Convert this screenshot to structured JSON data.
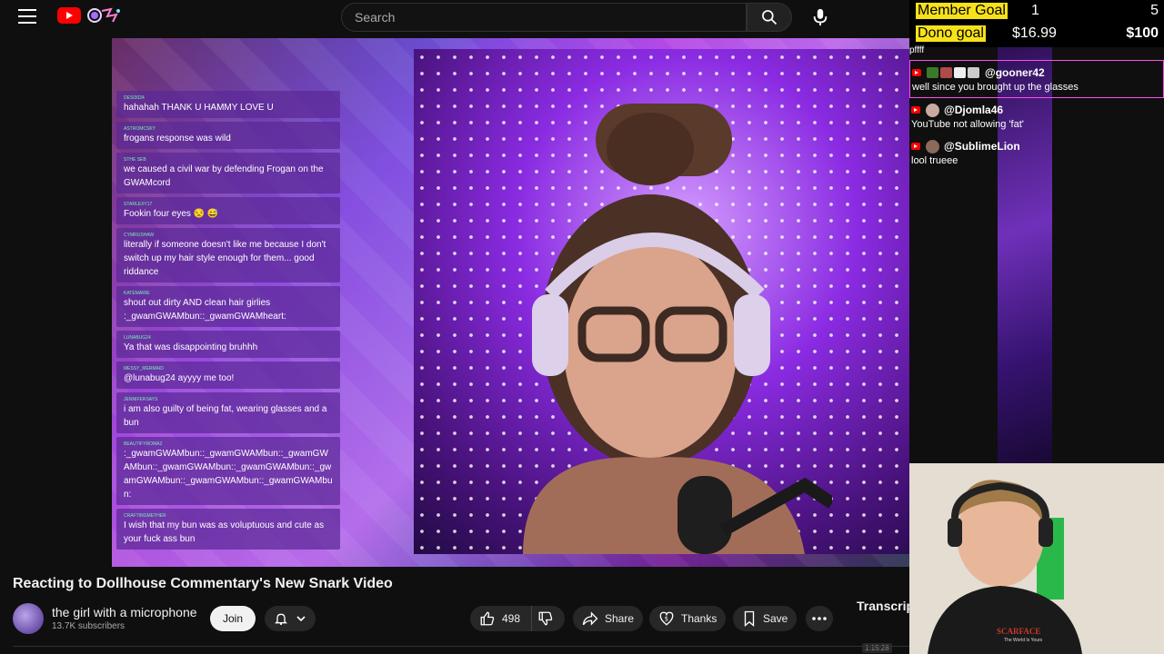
{
  "header": {
    "search_placeholder": "Search"
  },
  "video_chat_overlay": [
    {
      "user": "DESI3024",
      "text": "hahahah THANK U HAMMY LOVE U"
    },
    {
      "user": "ASTROMCSKY",
      "text": "frogans response was wild"
    },
    {
      "user": "STHE SEB",
      "text": "we caused a civil war by defending Frogan on the GWAMcord"
    },
    {
      "user": "STARLEXY17",
      "text": "Fookin four eyes 😒 😅"
    },
    {
      "user": "CYMRUSHAW",
      "text": "literally if someone doesn't like me because I don't switch up my hair style enough for them... good riddance"
    },
    {
      "user": "KATEMARIE",
      "text": "shout out dirty AND clean hair girlies :_gwamGWAMbun::_gwamGWAMheart:"
    },
    {
      "user": "LUNABUG24",
      "text": "Ya that was disappointing bruhhh"
    },
    {
      "user": "MESSY_MERMAID",
      "text": "@lunabug24 ayyyy me too!"
    },
    {
      "user": "JENNIFERSAYS",
      "text": "i am also guilty of being fat, wearing glasses and a bun"
    },
    {
      "user": "BEAUTIFYROMAZ",
      "text": ":_gwamGWAMbun::_gwamGWAMbun::_gwamGWAMbun::_gwamGWAMbun::_gwamGWAMbun::_gwamGWAMbun::_gwamGWAMbun::_gwamGWAMbun:"
    },
    {
      "user": "CRAFTINGMETHER",
      "text": "I wish that my bun was as voluptuous and cute as your fuck ass bun"
    }
  ],
  "goals": {
    "member_label": "Member Goal",
    "member_current": "1",
    "member_target": "5",
    "dono_label": "Dono goal",
    "dono_current": "$16.99",
    "dono_target": "$100"
  },
  "stream_chat": {
    "pre_text": "pffff",
    "messages": [
      {
        "user": "@gooner42",
        "text": "well since you brought up the glasses"
      },
      {
        "user": "@Djomla46",
        "text": "YouTube not allowing 'fat'"
      },
      {
        "user": "@SublimeLion",
        "text": "lool trueee"
      }
    ]
  },
  "video_info": {
    "title": "Reacting to Dollhouse Commentary's New Snark Video",
    "channel_name": "the girl with a microphone",
    "subscribers": "13.7K subscribers",
    "join_label": "Join",
    "likes": "498",
    "share_label": "Share",
    "thanks_label": "Thanks",
    "save_label": "Save",
    "transcript_label": "Transcript",
    "timestamp": "1:15:28"
  },
  "facecam": {
    "shirt_text": "SCARFACE",
    "shirt_sub": "The World Is Yours"
  }
}
